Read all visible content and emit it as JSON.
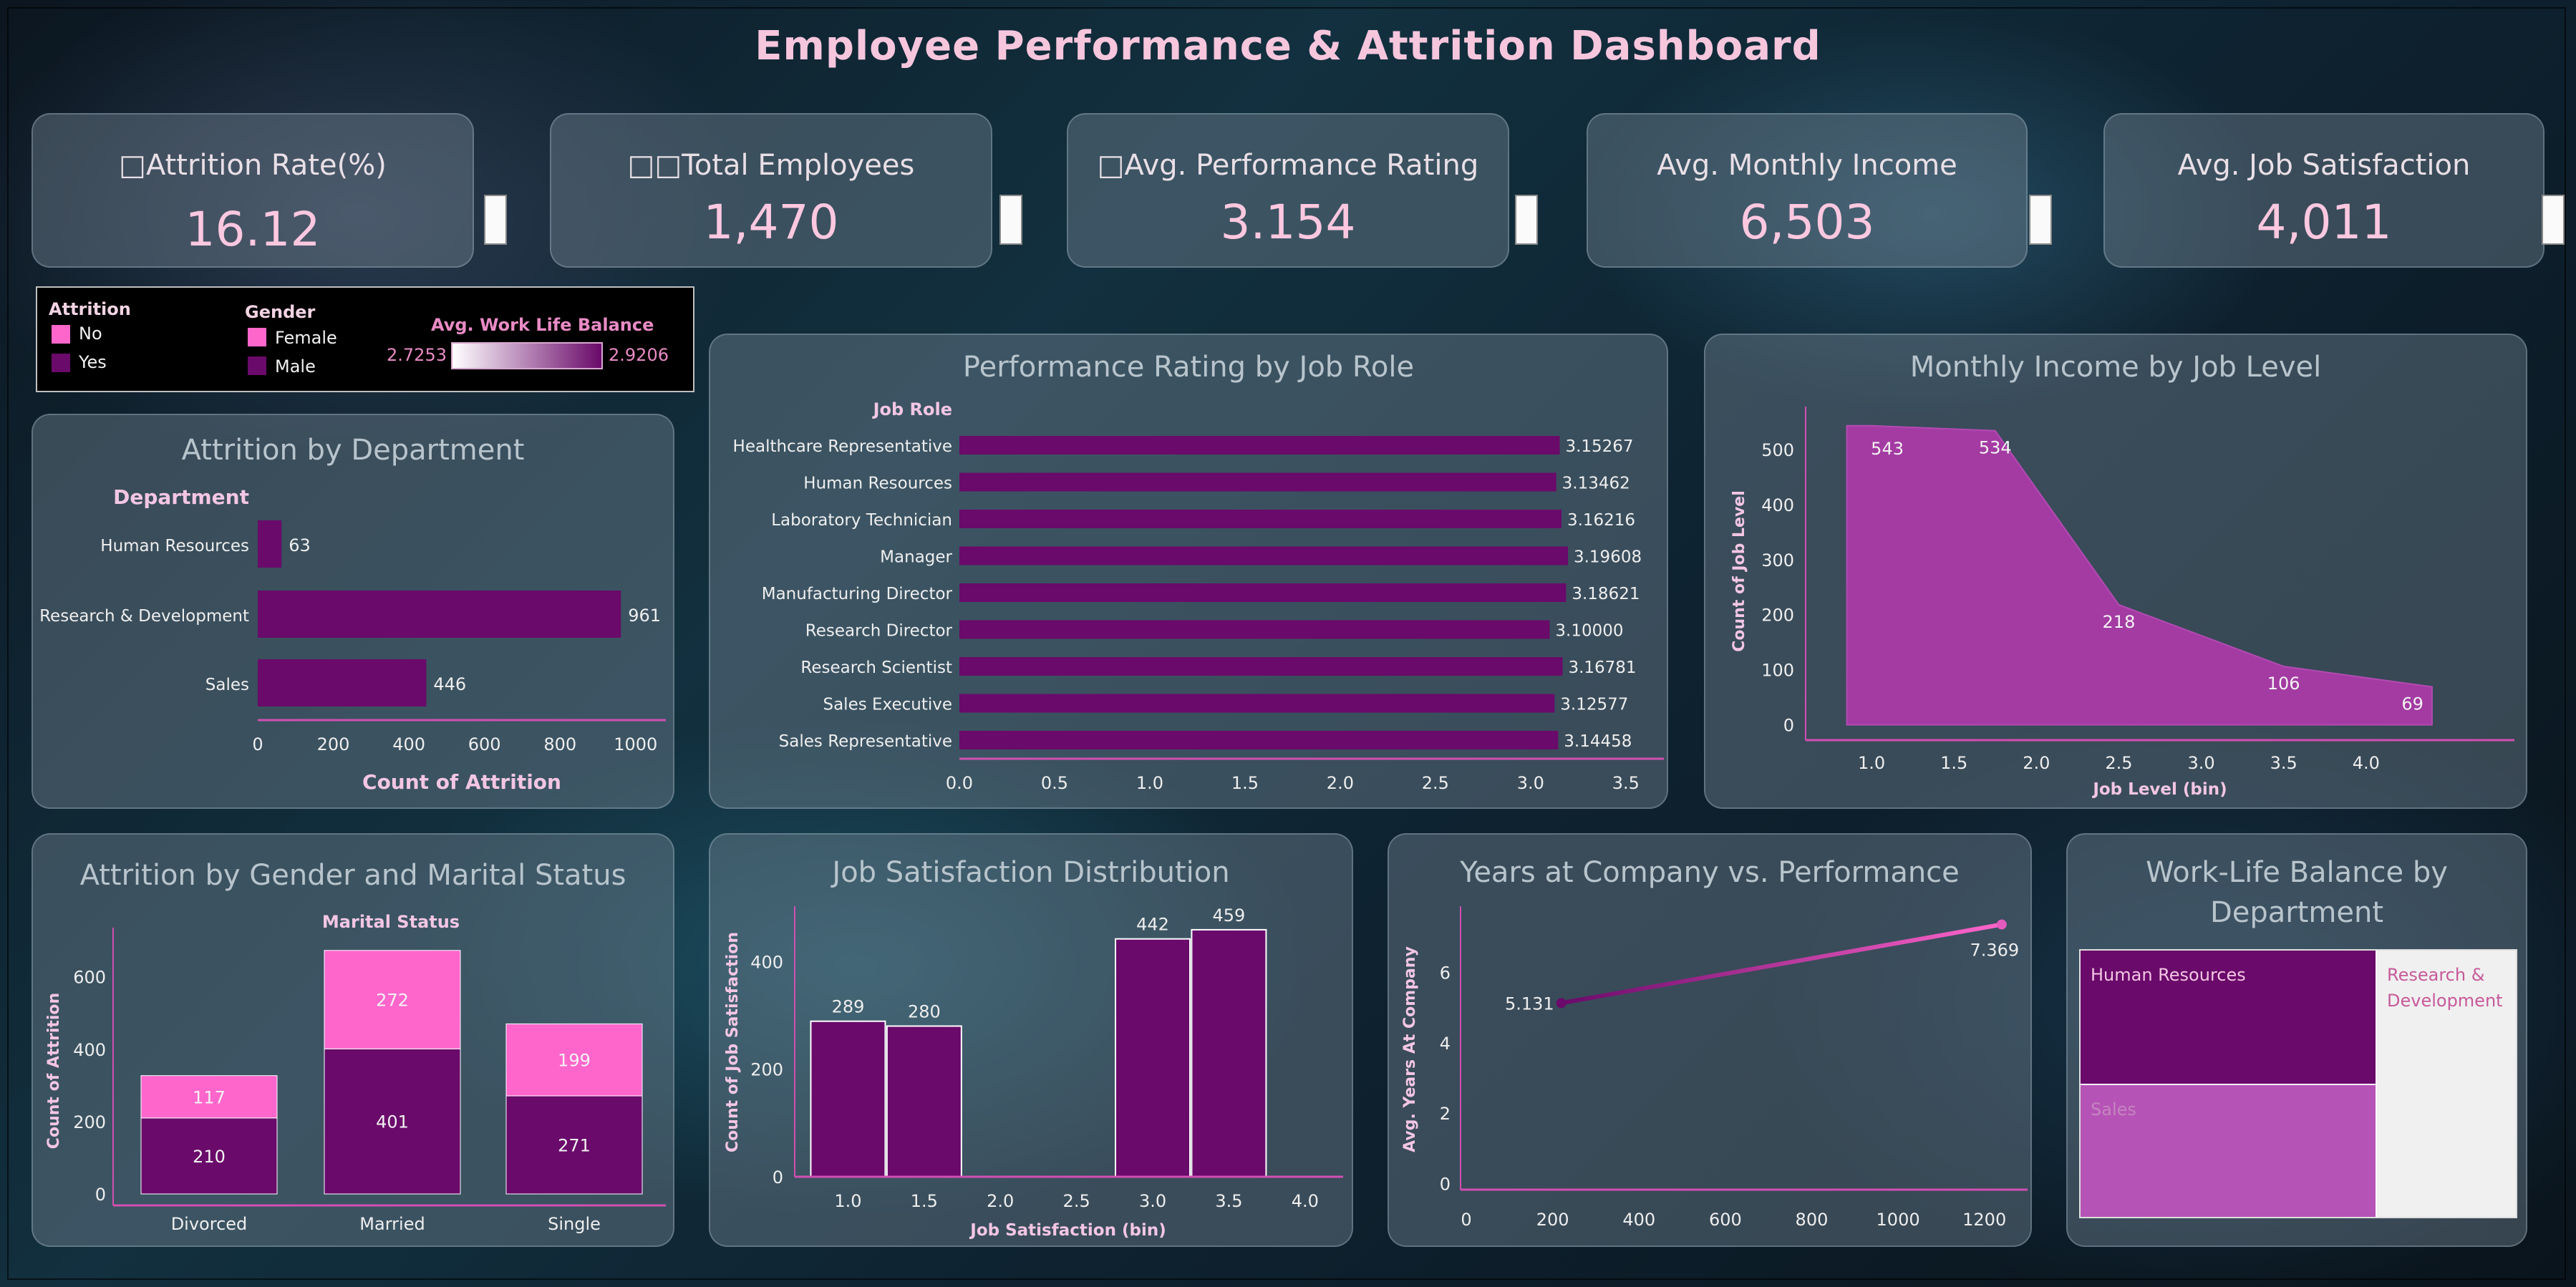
{
  "title": "Employee Performance & Attrition Dashboard",
  "colors": {
    "dark": "#6a0a6a",
    "pink": "#ff66cc",
    "purple": "#9c2f9c",
    "light": "#b653b6"
  },
  "kpis": [
    {
      "label": "□Attrition Rate(%)",
      "value": "16.12"
    },
    {
      "label": "□□Total Employees",
      "value": "1,470"
    },
    {
      "label": "□Avg. Performance Rating",
      "value": "3.154"
    },
    {
      "label": "Avg. Monthly Income",
      "value": "6,503"
    },
    {
      "label": "Avg. Job Satisfaction",
      "value": "4,011"
    }
  ],
  "legend": {
    "attrition_title": "Attrition",
    "attrition_items": [
      "No",
      "Yes"
    ],
    "gender_title": "Gender",
    "gender_items": [
      "Female",
      "Male"
    ],
    "wlb_title": "Avg. Work Life Balance",
    "wlb_min": "2.7253",
    "wlb_max": "2.9206"
  },
  "chart_data": [
    {
      "id": "dept",
      "type": "bar",
      "orientation": "horizontal",
      "title": "Attrition by Department",
      "category_header": "Department",
      "categories": [
        "Human Resources",
        "Research & Development",
        "Sales"
      ],
      "values": [
        63,
        961,
        446
      ],
      "value_labels": [
        "63",
        "961",
        "446"
      ],
      "xlabel": "Count of Attrition",
      "xlim": [
        0,
        1080
      ],
      "xticks": [
        0,
        200,
        400,
        600,
        800,
        1000
      ],
      "xtick_labels": [
        "0",
        "200",
        "400",
        "600",
        "800",
        "1000"
      ]
    },
    {
      "id": "perf",
      "type": "bar",
      "orientation": "horizontal",
      "title": "Performance Rating by Job Role",
      "category_header": "Job Role",
      "categories": [
        "Healthcare Representative",
        "Human Resources",
        "Laboratory Technician",
        "Manager",
        "Manufacturing Director",
        "Research Director",
        "Research Scientist",
        "Sales Executive",
        "Sales Representative"
      ],
      "values": [
        3.15267,
        3.13462,
        3.16216,
        3.19608,
        3.18621,
        3.1,
        3.16781,
        3.12577,
        3.14458
      ],
      "value_labels": [
        "3.15267",
        "3.13462",
        "3.16216",
        "3.19608",
        "3.18621",
        "3.10000",
        "3.16781",
        "3.12577",
        "3.14458"
      ],
      "xlim": [
        0,
        3.7
      ],
      "xticks": [
        0,
        0.5,
        1,
        1.5,
        2,
        2.5,
        3,
        3.5
      ],
      "xtick_labels": [
        "0.0",
        "0.5",
        "1.0",
        "1.5",
        "2.0",
        "2.5",
        "3.0",
        "3.5"
      ]
    },
    {
      "id": "income",
      "type": "area",
      "title": "Monthly Income by Job Level",
      "xlabel": "Job Level (bin)",
      "ylabel": "Count of Job Level",
      "x": [
        0.85,
        1.0,
        1.75,
        2.5,
        3.5,
        4.4
      ],
      "y": [
        543,
        543,
        534,
        218,
        106,
        69
      ],
      "point_labels": [
        {
          "x": 1.0,
          "y": 543,
          "label": "543"
        },
        {
          "x": 1.75,
          "y": 534,
          "label": "534"
        },
        {
          "x": 2.5,
          "y": 218,
          "label": "218"
        },
        {
          "x": 3.5,
          "y": 106,
          "label": "106"
        },
        {
          "x": 4.4,
          "y": 69,
          "label": "69"
        }
      ],
      "xlim": [
        0.6,
        4.9
      ],
      "ylim": [
        -20,
        570
      ],
      "xticks": [
        1,
        1.5,
        2,
        2.5,
        3,
        3.5,
        4
      ],
      "xtick_labels": [
        "1.0",
        "1.5",
        "2.0",
        "2.5",
        "3.0",
        "3.5",
        "4.0"
      ],
      "yticks": [
        0,
        100,
        200,
        300,
        400,
        500
      ],
      "ytick_labels": [
        "0",
        "100",
        "200",
        "300",
        "400",
        "500"
      ]
    },
    {
      "id": "gender",
      "type": "bar",
      "stacked": true,
      "title": "Attrition by Gender and Marital Status",
      "subtitle": "Marital Status",
      "categories": [
        "Divorced",
        "Married",
        "Single"
      ],
      "series": [
        {
          "name": "Male",
          "values": [
            210,
            401,
            271
          ],
          "labels": [
            "210",
            "401",
            "271"
          ]
        },
        {
          "name": "Female",
          "values": [
            117,
            272,
            199
          ],
          "labels": [
            "117",
            "272",
            "199"
          ]
        }
      ],
      "ylabel": "Count of Attrition",
      "ylim": [
        0,
        720
      ],
      "yticks": [
        0,
        200,
        400,
        600
      ],
      "ytick_labels": [
        "0",
        "200",
        "400",
        "600"
      ]
    },
    {
      "id": "jobsat",
      "type": "bar",
      "title": "Job Satisfaction Distribution",
      "xlabel": "Job Satisfaction (bin)",
      "ylabel": "Count of Job Satisfaction",
      "x": [
        1.0,
        1.5,
        3.0,
        3.5
      ],
      "values": [
        289,
        280,
        442,
        459
      ],
      "value_labels": [
        "289",
        "280",
        "442",
        "459"
      ],
      "xlim": [
        0.65,
        4.25
      ],
      "ylim": [
        0,
        540
      ],
      "xticks": [
        1,
        1.5,
        2,
        2.5,
        3,
        3.5,
        4
      ],
      "xtick_labels": [
        "1.0",
        "1.5",
        "2.0",
        "2.5",
        "3.0",
        "3.5",
        "4.0"
      ],
      "yticks": [
        0,
        200,
        400
      ],
      "ytick_labels": [
        "0",
        "200",
        "400"
      ]
    },
    {
      "id": "years",
      "type": "line",
      "title": "Years at Company vs. Performance",
      "ylabel": "Avg. Years At Company",
      "x": [
        220,
        1240
      ],
      "y": [
        5.131,
        7.369
      ],
      "point_labels": [
        "5.131",
        "7.369"
      ],
      "xlim": [
        0,
        1300
      ],
      "ylim": [
        -0.3,
        8.5
      ],
      "xticks": [
        0,
        200,
        400,
        600,
        800,
        1000,
        1200
      ],
      "xtick_labels": [
        "0",
        "200",
        "400",
        "600",
        "800",
        "1000",
        "1200"
      ],
      "yticks": [
        0,
        2,
        4,
        6
      ],
      "ytick_labels": [
        "0",
        "2",
        "4",
        "6"
      ]
    }
  ],
  "treemap": {
    "title_line1": "Work-Life Balance by",
    "title_line2": "Department",
    "cells": [
      {
        "label": "Human Resources",
        "color": "#6a0a6a",
        "text_color": "#f3c6e4"
      },
      {
        "label_line1": "Research &",
        "label_line2": "Development",
        "color": "#f0f0f0",
        "text_color": "#c75a9a"
      },
      {
        "label": "Sales",
        "color": "#b653b6",
        "text_color": "#b78ab8"
      }
    ]
  }
}
